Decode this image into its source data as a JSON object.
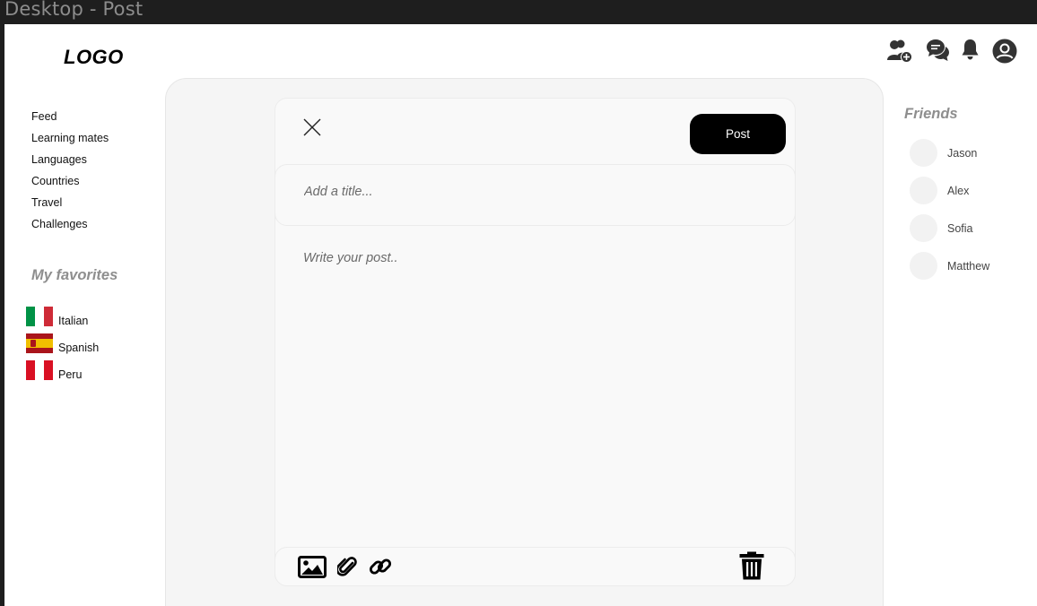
{
  "window": {
    "title": "Desktop - Post"
  },
  "header": {
    "logo": "LOGO"
  },
  "nav": {
    "items": [
      "Feed",
      "Learning mates",
      "Languages",
      "Countries",
      "Travel",
      "Challenges"
    ]
  },
  "favorites": {
    "title": "My favorites",
    "items": [
      {
        "label": "Italian",
        "icon": "italy-flag-icon"
      },
      {
        "label": "Spanish",
        "icon": "spain-flag-icon"
      },
      {
        "label": "Peru",
        "icon": "peru-flag-icon"
      }
    ]
  },
  "composer": {
    "post_label": "Post",
    "title_placeholder": "Add a title...",
    "body_placeholder": "Write your post..",
    "toolbar_icons": [
      "image-icon",
      "paperclip-icon",
      "link-icon",
      "trash-icon"
    ]
  },
  "top_icons": [
    "add-friend-icon",
    "chat-icon",
    "bell-icon",
    "profile-icon"
  ],
  "friends": {
    "title": "Friends",
    "items": [
      "Jason",
      "Alex",
      "Sofia",
      "Matthew"
    ]
  },
  "colors": {
    "frame_bg": "#1e1e1e",
    "panel_bg": "#f5f5f5",
    "primary_button": "#000000",
    "muted_heading": "#8e8e8e",
    "italy_flag": [
      "#009246",
      "#ffffff",
      "#ce2b37"
    ],
    "spain_flag": [
      "#aa151b",
      "#f1bf00",
      "#aa151b"
    ],
    "peru_flag": [
      "#d91023",
      "#ffffff",
      "#d91023"
    ]
  }
}
